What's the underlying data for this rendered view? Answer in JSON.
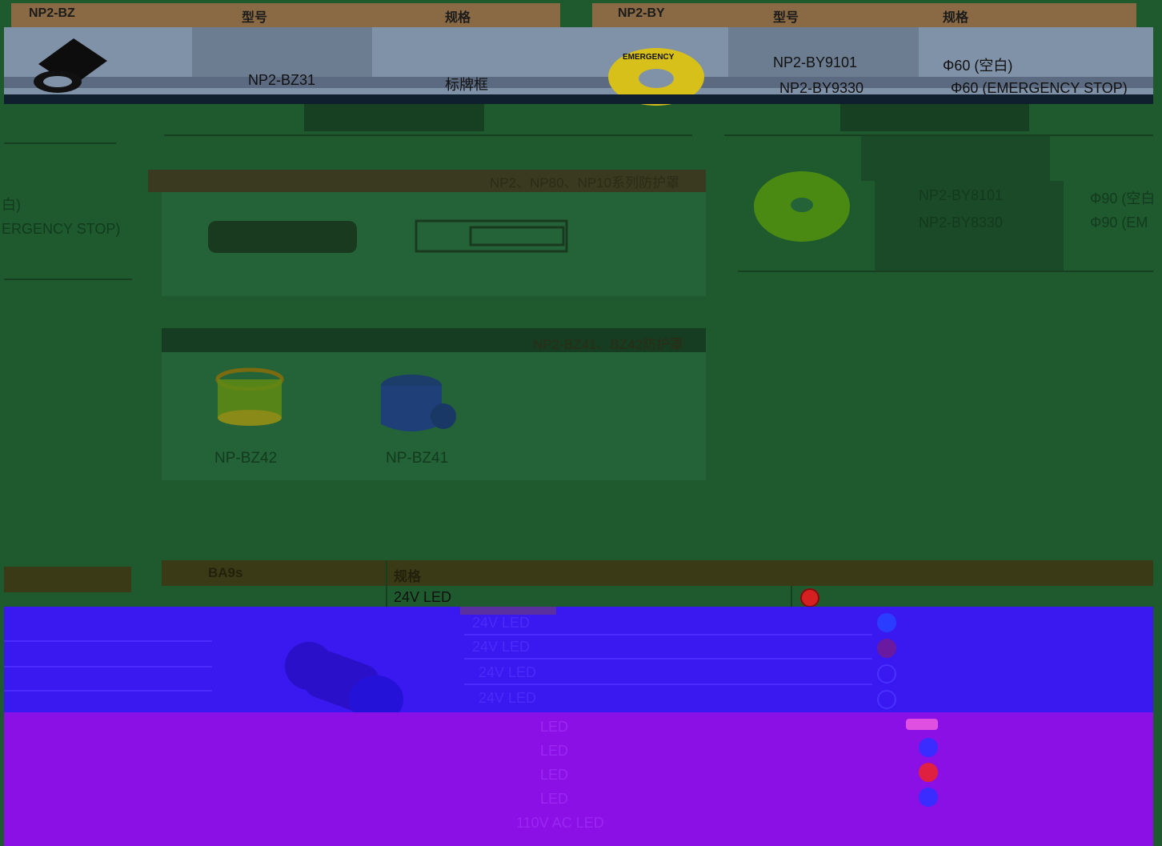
{
  "top_table": {
    "left": {
      "col_model_group": "NP2-BZ",
      "col_type": "型号",
      "col_spec": "规格",
      "row_model": "NP2-BZ31",
      "row_spec": "标牌框"
    },
    "right": {
      "col_model_group": "NP2-BY",
      "col_type": "型号",
      "col_spec": "规格",
      "row1_model": "NP2-BY9101",
      "row1_spec": "Φ60 (空白)",
      "row2_model": "NP2-BY9330",
      "row2_spec": "Φ60 (EMERGENCY STOP)"
    }
  },
  "left_partial": {
    "line1": "白)",
    "line2": "ERGENCY STOP)"
  },
  "guard_panel_1": {
    "title": "NP2、NP80、NP10系列防护罩"
  },
  "guard_panel_2": {
    "title": "NP2-BZ41、BZ42防护罩",
    "item1_label": "NP-BZ42",
    "item2_label": "NP-BZ41"
  },
  "right_table": {
    "row1_model": "NP2-BY8101",
    "row1_spec": "Φ90 (空白",
    "row2_model": "NP2-BY8330",
    "row2_spec": "Φ90 (EM"
  },
  "emergency_label": "EMERGENCY",
  "bulb_table": {
    "col_base": "BA9s",
    "col_spec": "规格",
    "rows": [
      "24V LED",
      "24V LED",
      "24V LED",
      "24V LED",
      "24V LED",
      "LED",
      "LED",
      "LED",
      "LED",
      "110V AC LED"
    ]
  },
  "colors": {
    "bg_green": "#1f5a2f",
    "panel_green": "#236337",
    "header_brown": "#6b4a2a",
    "band_blue": "#3a18f0",
    "band_purple": "#8b10e6",
    "led_red": "#d42020",
    "led_blue": "#2a3cff"
  }
}
